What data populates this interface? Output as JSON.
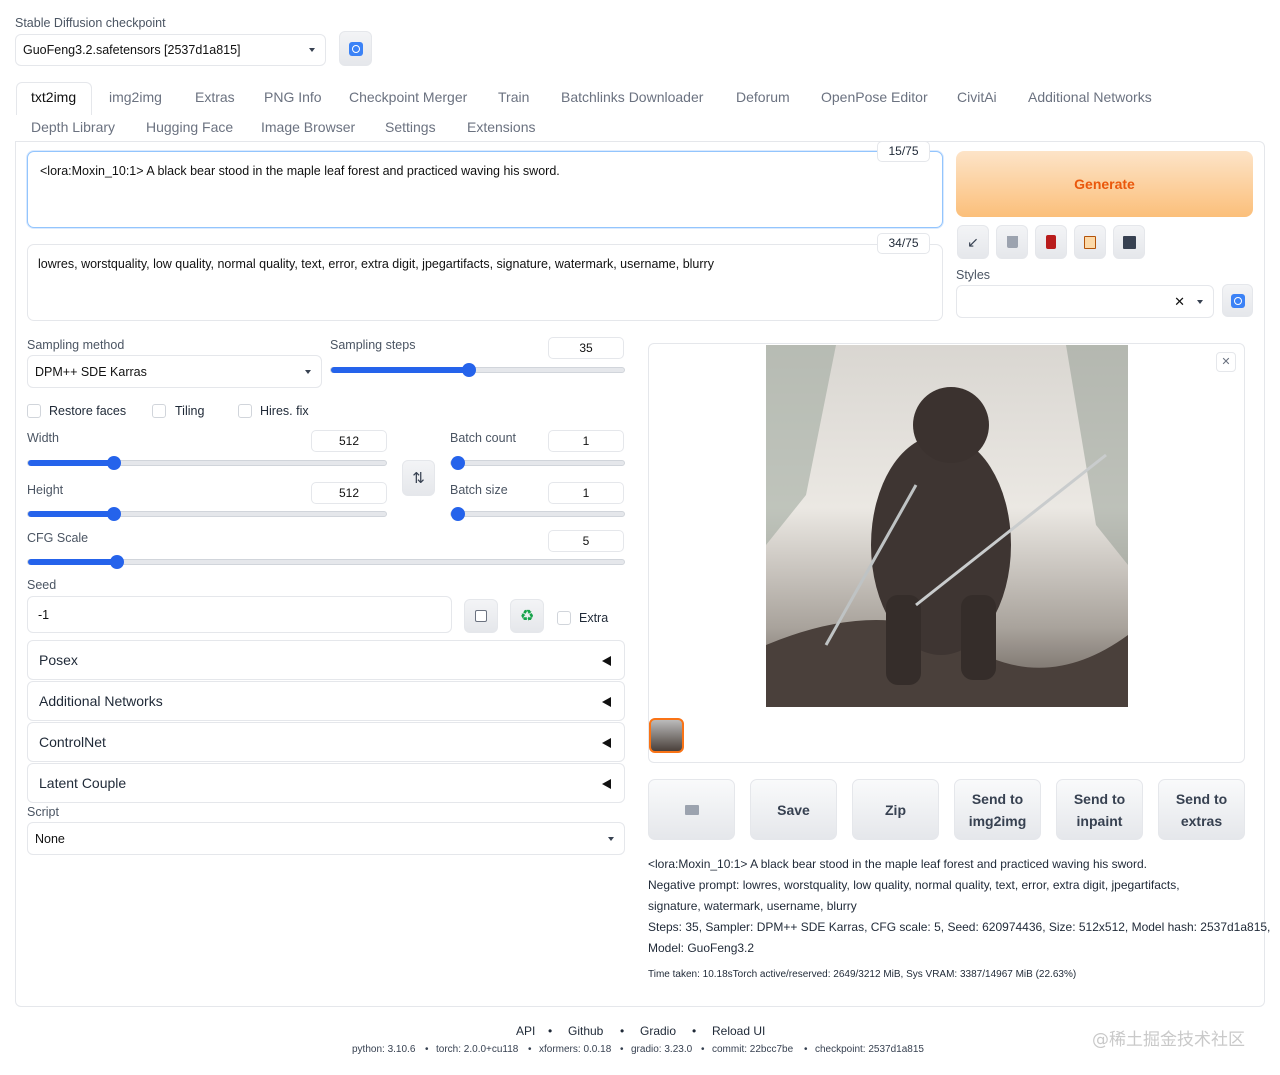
{
  "checkpoint": {
    "label": "Stable Diffusion checkpoint",
    "value": "GuoFeng3.2.safetensors [2537d1a815]"
  },
  "tabs_row1": [
    "txt2img",
    "img2img",
    "Extras",
    "PNG Info",
    "Checkpoint Merger",
    "Train",
    "Batchlinks Downloader",
    "Deforum",
    "OpenPose Editor",
    "CivitAi",
    "Additional Networks"
  ],
  "tabs_row2": [
    "Depth Library",
    "Hugging Face",
    "Image Browser",
    "Settings",
    "Extensions"
  ],
  "prompt": {
    "value": "<lora:Moxin_10:1> A black bear stood in the maple leaf forest and practiced waving his sword.",
    "counter": "15/75"
  },
  "negative_prompt": {
    "value": "lowres, worstquality, low quality, normal quality, text, error, extra digit, jpegartifacts, signature, watermark, username, blurry",
    "counter": "34/75"
  },
  "generate_label": "Generate",
  "styles_label": "Styles",
  "sampling": {
    "method_label": "Sampling method",
    "method": "DPM++ SDE Karras",
    "steps_label": "Sampling steps",
    "steps": "35",
    "steps_frac": 0.47
  },
  "checkboxes": {
    "restore_faces": "Restore faces",
    "tiling": "Tiling",
    "hires_fix": "Hires. fix",
    "extra": "Extra"
  },
  "width": {
    "label": "Width",
    "value": "512",
    "frac": 0.24
  },
  "height": {
    "label": "Height",
    "value": "512",
    "frac": 0.24
  },
  "batch_count": {
    "label": "Batch count",
    "value": "1",
    "frac": 0.0
  },
  "batch_size": {
    "label": "Batch size",
    "value": "1",
    "frac": 0.0
  },
  "cfg": {
    "label": "CFG Scale",
    "value": "5",
    "frac": 0.15
  },
  "seed": {
    "label": "Seed",
    "value": "-1"
  },
  "accordions": [
    "Posex",
    "Additional Networks",
    "ControlNet",
    "Latent Couple"
  ],
  "script": {
    "label": "Script",
    "value": "None"
  },
  "gallery_buttons": [
    "Save",
    "Zip",
    "Send to img2img",
    "Send to inpaint",
    "Send to extras"
  ],
  "info": {
    "line1": "<lora:Moxin_10:1> A black bear stood in the maple leaf forest and practiced waving his sword.",
    "line2": "Negative prompt: lowres, worstquality, low quality, normal quality, text, error, extra digit, jpegartifacts,",
    "line3": "signature, watermark, username, blurry",
    "line4": "Steps: 35, Sampler: DPM++ SDE Karras, CFG scale: 5, Seed: 620974436, Size: 512x512, Model hash: 2537d1a815,",
    "line5": "Model: GuoFeng3.2",
    "time": "Time taken: 10.18sTorch active/reserved: 2649/3212 MiB, Sys VRAM: 3387/14967 MiB (22.63%)"
  },
  "footer": {
    "links": [
      "API",
      "Github",
      "Gradio",
      "Reload UI"
    ],
    "python": "python: 3.10.6",
    "torch": "torch: 2.0.0+cu118",
    "xformers": "xformers: 0.0.18",
    "gradio": "gradio: 3.23.0",
    "commit": "commit: 22bcc7be",
    "checkpoint": "checkpoint: 2537d1a815"
  },
  "watermark": "@稀土掘金技术社区",
  "colors": {
    "accent": "#2563eb",
    "generate_from": "#fde4c8",
    "generate_to": "#fbbf7a",
    "generate_text": "#ea580c"
  }
}
